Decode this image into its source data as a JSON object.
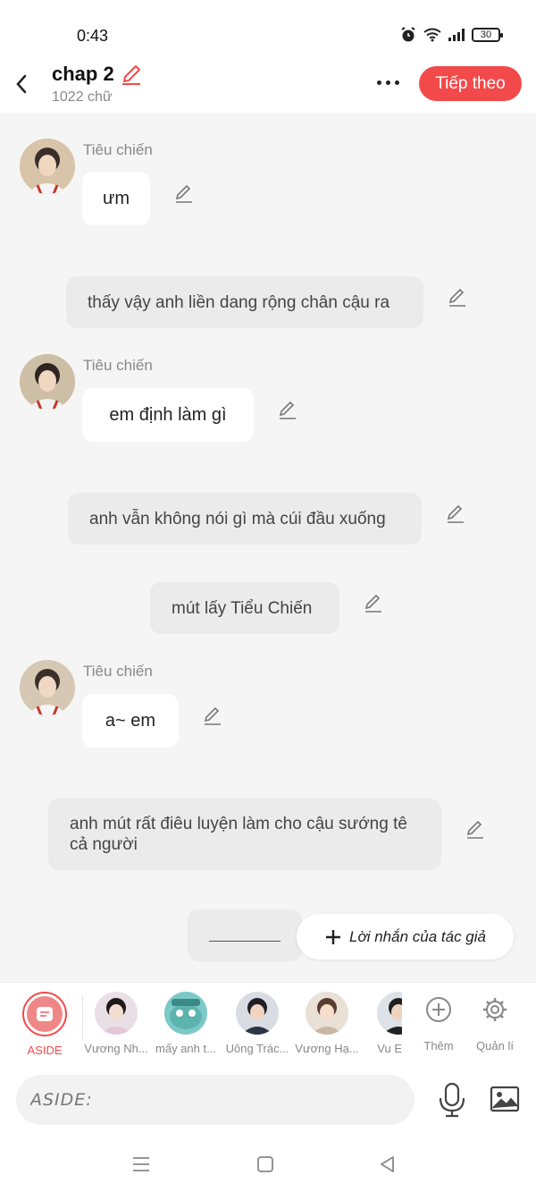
{
  "status": {
    "time": "0:43",
    "battery": "30"
  },
  "header": {
    "title": "chap 2",
    "word_count": "1022 chữ",
    "next_label": "Tiếp theo"
  },
  "messages": [
    {
      "type": "character",
      "sender": "Tiêu chiến",
      "text": "ưm"
    },
    {
      "type": "narration",
      "text": "thấy vậy anh liền dang rộng chân cậu ra"
    },
    {
      "type": "character",
      "sender": "Tiêu chiến",
      "text": "em định làm gì"
    },
    {
      "type": "narration",
      "text": "anh vẫn không nói gì mà cúi đầu xuống"
    },
    {
      "type": "narration",
      "text": "mút lấy Tiểu Chiến"
    },
    {
      "type": "character",
      "sender": "Tiêu chiến",
      "text": "a~ em"
    },
    {
      "type": "narration",
      "text": "anh mút rất điêu luyện làm cho cậu sướng tê cả người"
    },
    {
      "type": "narration",
      "text": "______"
    }
  ],
  "author_note_label": "Lời nhắn của tác giả",
  "characters": [
    {
      "name": "ASIDE"
    },
    {
      "name": "Vương Nh..."
    },
    {
      "name": "mấy anh t..."
    },
    {
      "name": "Uông Trác..."
    },
    {
      "name": "Vương Hạ..."
    },
    {
      "name": "Vu E"
    },
    {
      "name": "Thêm"
    },
    {
      "name": "Quản lí"
    }
  ],
  "input": {
    "placeholder": "ASIDE:"
  },
  "colors": {
    "accent": "#f24a4a",
    "narration_bg": "#ebebeb",
    "page_bg": "#f5f5f5"
  },
  "icons": [
    "back-arrow-icon",
    "pencil-icon",
    "more-icon",
    "edit-icon",
    "plus-icon",
    "gear-icon",
    "mic-icon",
    "image-icon",
    "menu-icon",
    "home-icon",
    "back-icon"
  ]
}
